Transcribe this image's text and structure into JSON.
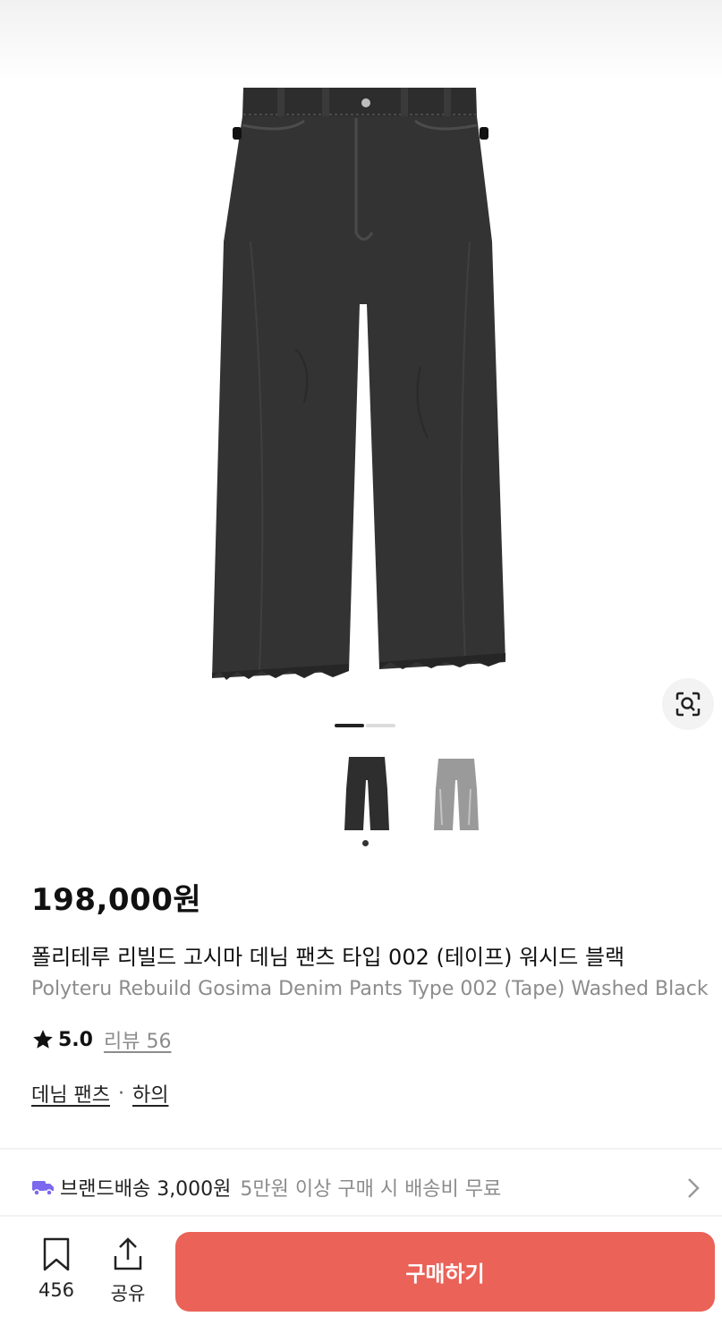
{
  "product": {
    "price": "198,000원",
    "name_ko": "폴리테루 리빌드 고시마 데님 팬츠 타입 002 (테이프) 워시드 블랙",
    "name_en": "Polyteru Rebuild Gosima Denim Pants Type 002 (Tape) Washed Black",
    "rating": "5.0",
    "review_link": "리뷰 56",
    "categories": [
      "데님 팬츠",
      "하의"
    ],
    "category_separator": "·",
    "gallery": {
      "current": 1,
      "total": 2
    }
  },
  "icons": {
    "lens": "camera-search-icon",
    "star": "star-icon",
    "shipping": "truck-icon",
    "chevron": "chevron-right-icon",
    "bookmark": "bookmark-icon",
    "share": "share-icon"
  },
  "shipping": {
    "label": "브랜드배송 3,000원",
    "note": "5만원 이상 구매 시 배송비 무료"
  },
  "bottom_bar": {
    "bookmark_count": "456",
    "share_label": "공유",
    "buy_label": "구매하기"
  },
  "colors": {
    "accent": "#ea6258",
    "truck": "#7b68ee",
    "muted_text": "#8c8c8c",
    "denim_black": "#2e2e2e",
    "denim_gray": "#9a9a9a"
  }
}
